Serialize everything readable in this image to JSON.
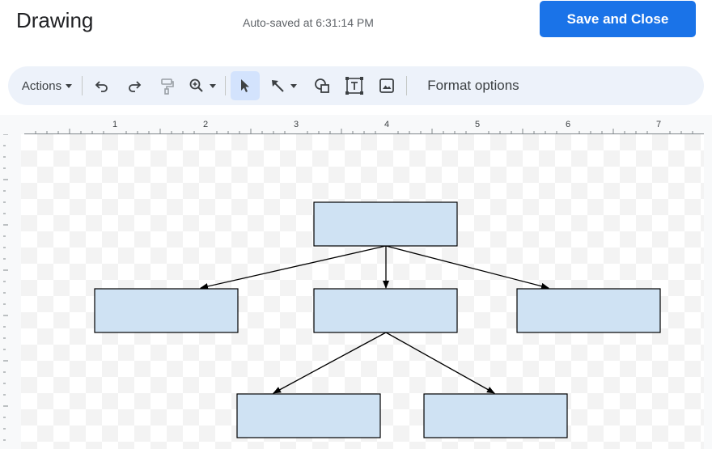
{
  "header": {
    "title": "Drawing",
    "autosave": "Auto-saved at 6:31:14 PM",
    "save_label": "Save and Close"
  },
  "toolbar": {
    "actions_label": "Actions",
    "format_label": "Format options",
    "icons": [
      "undo-icon",
      "redo-icon",
      "paint-format-icon",
      "zoom-icon",
      "select-arrow-icon",
      "line-icon",
      "shape-icon",
      "text-box-icon",
      "image-icon"
    ]
  },
  "ruler": {
    "labels": [
      "1",
      "2",
      "3",
      "4",
      "5",
      "6",
      "7"
    ]
  },
  "colors": {
    "accent": "#1a73e8",
    "toolbar_bg": "#edf2fa",
    "shape_fill": "#cfe2f3",
    "shape_stroke": "#000000"
  },
  "diagram": {
    "shapes": [
      "top-box",
      "middle-left-box",
      "middle-center-box",
      "middle-right-box",
      "bottom-left-box",
      "bottom-right-box"
    ],
    "arrows": [
      "top-to-left",
      "top-to-center",
      "top-to-right",
      "center-to-bottom-left",
      "center-to-bottom-right"
    ]
  }
}
